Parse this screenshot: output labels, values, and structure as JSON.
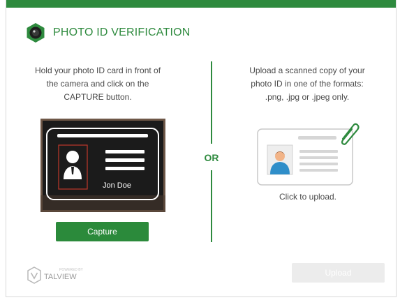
{
  "header": {
    "title": "PHOTO ID VERIFICATION"
  },
  "left": {
    "instruction_lines": [
      "Hold your photo ID card in front of",
      "the camera and click on the",
      "CAPTURE button."
    ],
    "sample_name": "Jon Doe",
    "capture_label": "Capture"
  },
  "separator": {
    "label": "OR"
  },
  "right": {
    "instruction_lines": [
      "Upload a scanned copy of your",
      "photo ID in one of the formats:",
      ".png, .jpg or .jpeg only."
    ],
    "click_label": "Click to upload."
  },
  "footer": {
    "powered_by": "POWERED BY",
    "brand": "TALVIEW",
    "upload_label": "Upload"
  },
  "colors": {
    "accent": "#2e8a3e",
    "button": "#2b8a3b",
    "disabled": "#ececec"
  }
}
